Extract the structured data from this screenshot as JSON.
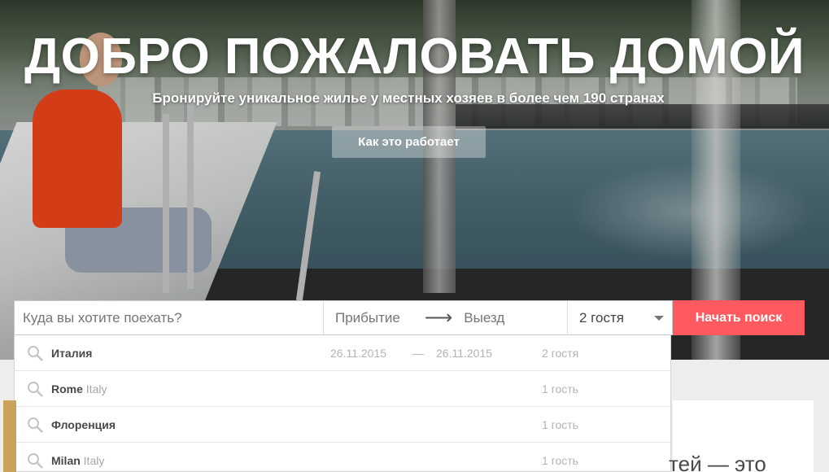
{
  "hero": {
    "title": "ДОБРО ПОЖАЛОВАТЬ ДОМОЙ",
    "subtitle": "Бронируйте уникальное жилье у местных хозяев в более чем 190 странах",
    "how_button": "Как это работает"
  },
  "search": {
    "destination_placeholder": "Куда вы хотите поехать?",
    "checkin_label": "Прибытие",
    "checkout_label": "Выезд",
    "guests_value": "2 гостя",
    "search_button": "Начать поиск"
  },
  "suggestions": [
    {
      "name": "Италия",
      "country": "",
      "checkin": "26.11.2015",
      "dash": "—",
      "checkout": "26.11.2015",
      "guests": "2 гостя"
    },
    {
      "name": "Rome",
      "country": "Italy",
      "checkin": "",
      "dash": "",
      "checkout": "",
      "guests": "1 гость"
    },
    {
      "name": "Флоренция",
      "country": "",
      "checkin": "",
      "dash": "",
      "checkout": "",
      "guests": "1 гость"
    },
    {
      "name": "Milan",
      "country": "Italy",
      "checkin": "",
      "dash": "",
      "checkout": "",
      "guests": "1 гость"
    }
  ],
  "below": {
    "partial_heading": "тей — это"
  },
  "colors": {
    "accent": "#ff5a5f",
    "text": "#484848",
    "muted": "#b3b3b3"
  }
}
